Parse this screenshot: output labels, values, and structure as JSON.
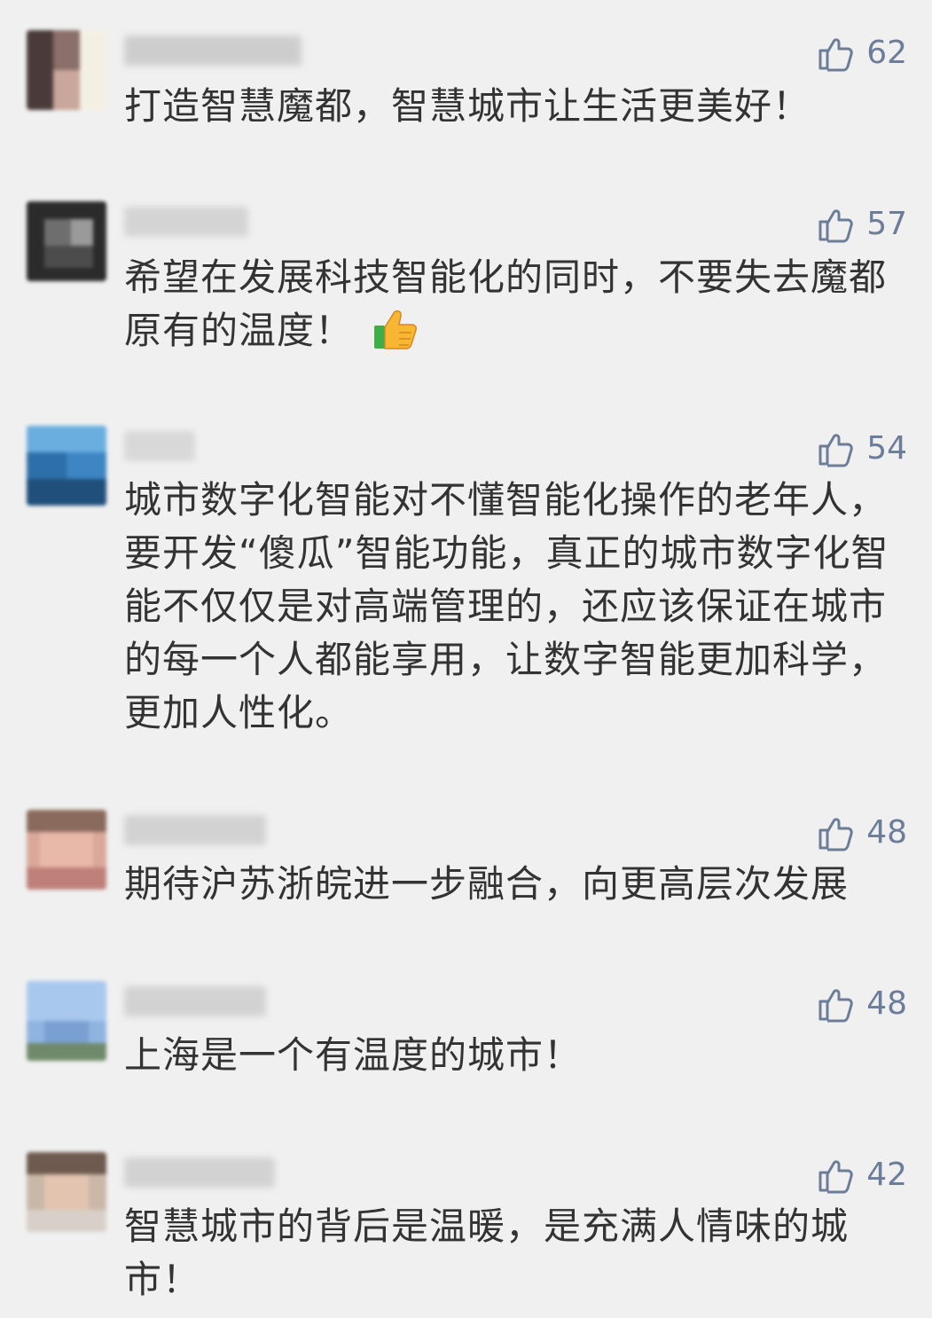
{
  "comments": [
    {
      "likes": "62",
      "text": "打造智慧魔都，智慧城市让生活更美好！"
    },
    {
      "likes": "57",
      "text": "希望在发展科技智能化的同时，不要失去魔都原有的温度！",
      "emoji": "thumbs-up-emoji"
    },
    {
      "likes": "54",
      "text": "城市数字化智能对不懂智能化操作的老年人，要开发“傻瓜”智能功能，真正的城市数字化智能不仅仅是对高端管理的，还应该保证在城市的每一个人都能享用，让数字智能更加科学，更加人性化。"
    },
    {
      "likes": "48",
      "text": "期待沪苏浙皖进一步融合，向更高层次发展"
    },
    {
      "likes": "48",
      "text": "上海是一个有温度的城市！"
    },
    {
      "likes": "42",
      "text": "智慧城市的背后是温暖，是充满人情味的城市！"
    }
  ],
  "colors": {
    "background": "#f0f0f0",
    "text": "#333333",
    "like": "#6b7d99"
  },
  "icons": {
    "like": "thumbs-up-outline-icon"
  }
}
